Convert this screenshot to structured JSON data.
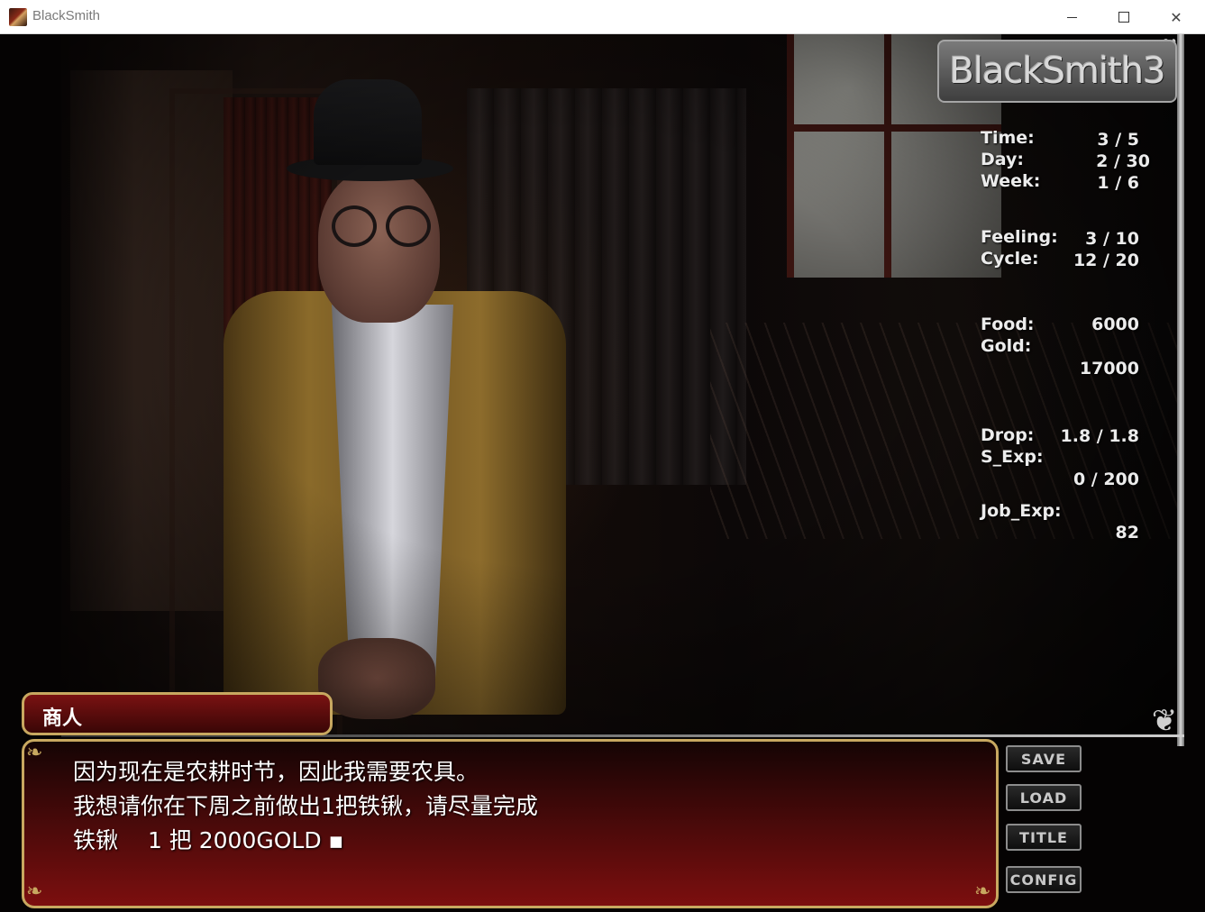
{
  "window": {
    "title": "BlackSmith",
    "minimize_icon": "minimize-icon",
    "maximize_icon": "maximize-icon",
    "close_icon": "close-icon"
  },
  "logo": {
    "text": "BlackSmith3"
  },
  "stats": {
    "time": {
      "label": "Time:",
      "value": "3 / 5"
    },
    "day": {
      "label": "Day:",
      "value": "2 / 30"
    },
    "week": {
      "label": "Week:",
      "value": "1 / 6"
    },
    "feeling": {
      "label": "Feeling:",
      "value": "3 / 10"
    },
    "cycle": {
      "label": "Cycle:",
      "value": "12 / 20"
    },
    "food": {
      "label": "Food:",
      "value": "6000"
    },
    "gold": {
      "label": "Gold:",
      "value": "17000"
    },
    "drop": {
      "label": "Drop:",
      "value": "1.8 / 1.8"
    },
    "s_exp": {
      "label": "S_Exp:",
      "value": "0 / 200"
    },
    "job_exp": {
      "label": "Job_Exp:",
      "value": "82"
    }
  },
  "dialog": {
    "speaker": "商人",
    "lines": [
      "因为现在是农耕时节，因此我需要农具。",
      "我想请你在下周之前做出1把铁锹，请尽量完成",
      "铁锹　 1 把 2000GOLD ▪"
    ]
  },
  "menu": {
    "save": "SAVE",
    "load": "LOAD",
    "title": "TITLE",
    "config": "CONFIG"
  },
  "colors": {
    "dialog_border": "#c8a860",
    "dialog_bg": "#7c0f0f",
    "stat_text": "#ececec"
  }
}
